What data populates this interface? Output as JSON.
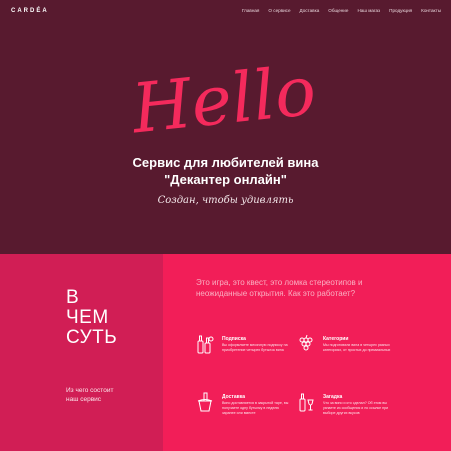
{
  "brand": "CARDÉA",
  "nav": [
    "Главная",
    "О сервисе",
    "Доставка",
    "Общение",
    "Наш магаз",
    "Продукция",
    "Контакты"
  ],
  "hero": {
    "hello": "Hello",
    "tagline_line1": "Сервис для любителей вина",
    "tagline_line2": "\"Декантер онлайн\"",
    "slogan": "Создан, чтобы удивлять"
  },
  "about": {
    "big_lines": [
      "В",
      "ЧЕМ",
      "СУТЬ"
    ],
    "subtitle_lines": [
      "Из чего состоит",
      "наш сервис"
    ],
    "intro": "Это игра, это квест, это ломка стереотипов и неожиданные открытия. Как это работает?",
    "features": [
      {
        "title": "Подписка",
        "desc": "Вы оформляете месячную подписку на приобретение четырех бутылок вина",
        "icon": "bottles-icon"
      },
      {
        "title": "Категории",
        "desc": "Мы подготовили вина в четырех разных категориях, от простых до премиальных",
        "icon": "grapes-icon"
      },
      {
        "title": "Доставка",
        "desc": "Вино доставляется в закрытой таре, вы получаете одну бутылку в неделю заранее или вместе",
        "icon": "bucket-icon"
      },
      {
        "title": "Загадка",
        "desc": "Что за вино и кто сделал? Об этом вы узнаете из сообщения и по ссылке при выборе других вкусов",
        "icon": "bottle-glass-icon"
      }
    ]
  },
  "colors": {
    "hero_bg": "#581a2f",
    "accent_left": "#d11e55",
    "accent_right": "#f21e58",
    "hello": "#f42a5c"
  }
}
